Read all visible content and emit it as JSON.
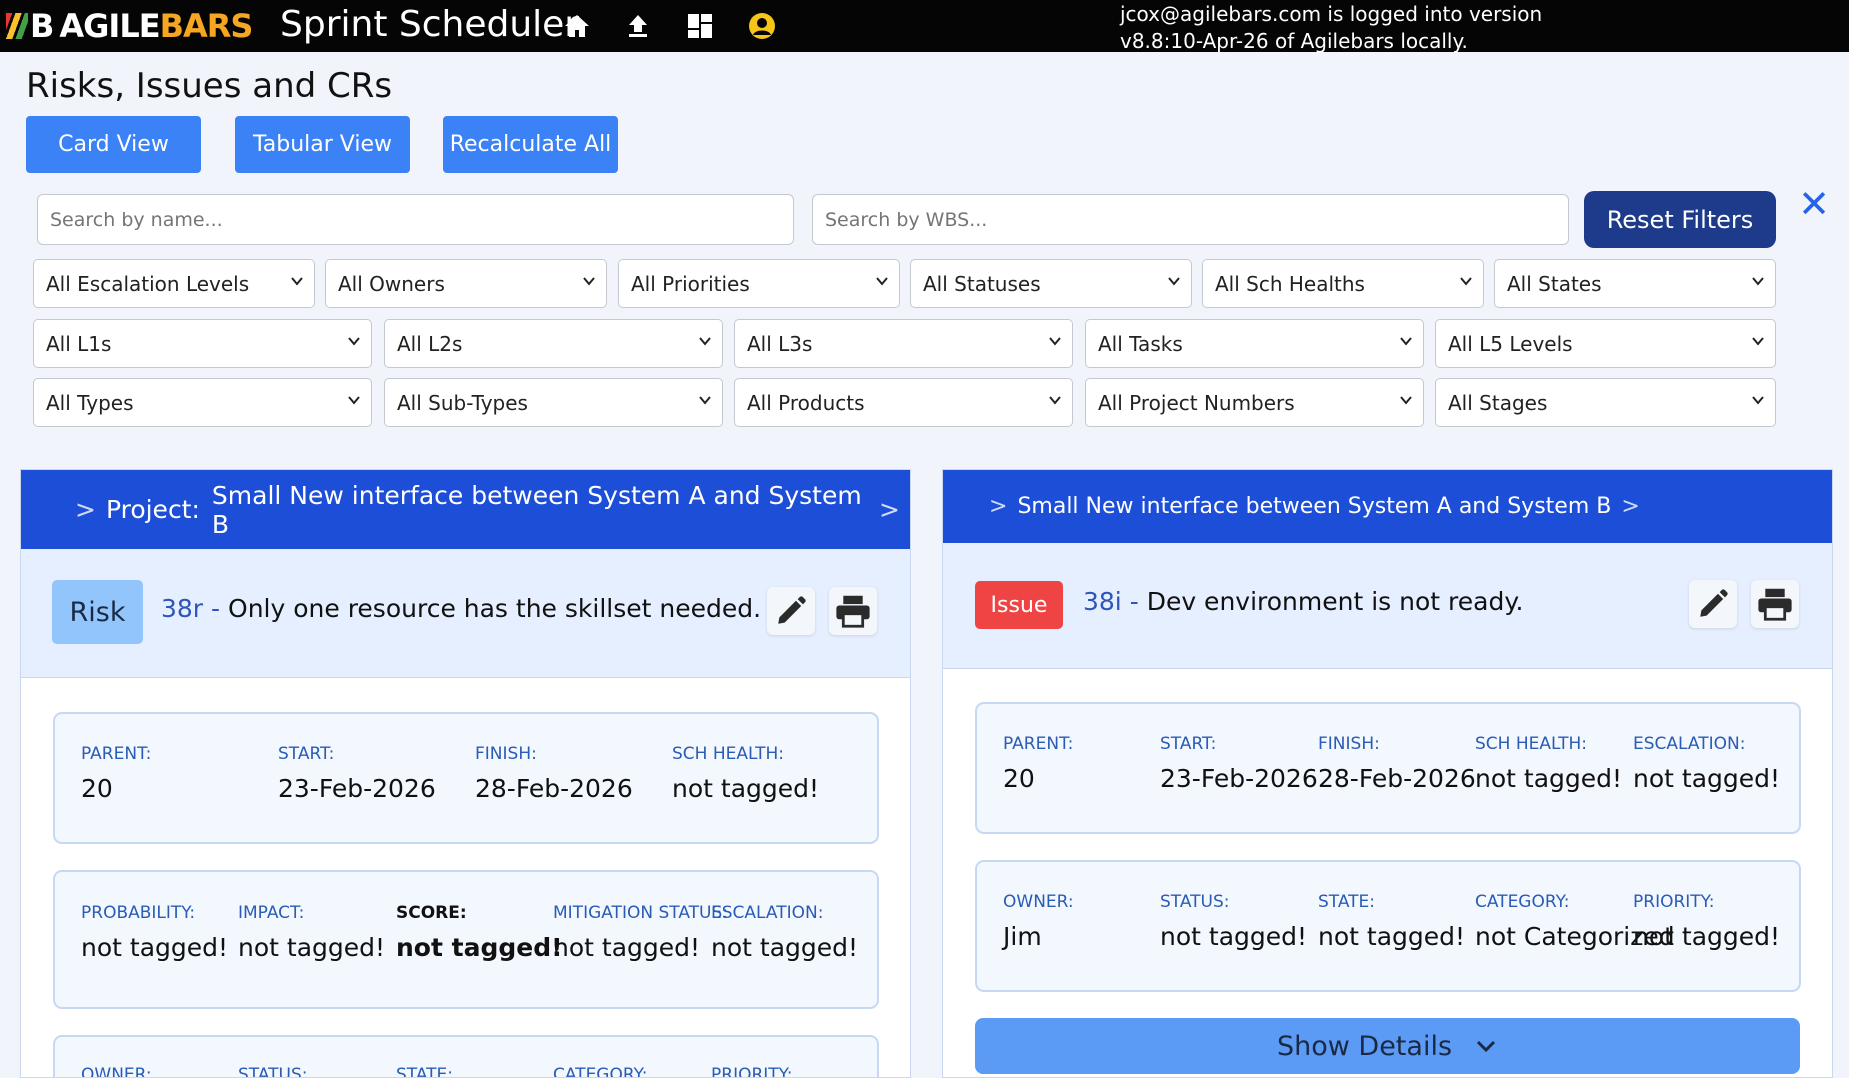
{
  "header": {
    "logo_mark": "B",
    "logo_agile": "AGILE",
    "logo_bars": "BARS",
    "app_name": "Sprint Scheduler",
    "login_line1": "jcox@agilebars.com is logged into version",
    "login_line2": "v8.8:10-Apr-26 of Agilebars locally."
  },
  "page": {
    "title": "Risks, Issues and CRs",
    "buttons": {
      "card_view": "Card View",
      "tabular_view": "Tabular View",
      "recalculate_all": "Recalculate All"
    },
    "search_name_placeholder": "Search by name...",
    "search_wbs_placeholder": "Search by WBS...",
    "reset_filters": "Reset Filters",
    "close": "✕"
  },
  "filters": {
    "row1": [
      "All Escalation Levels",
      "All Owners",
      "All Priorities",
      "All Statuses",
      "All Sch Healths",
      "All States"
    ],
    "row2": [
      "All L1s",
      "All L2s",
      "All L3s",
      "All Tasks",
      "All L5 Levels"
    ],
    "row3": [
      "All Types",
      "All Sub-Types",
      "All Products",
      "All Project Numbers",
      "All Stages"
    ]
  },
  "cards": [
    {
      "header_prefix": "Project:",
      "header_title": "Small New interface between System A and System B",
      "type_badge": "Risk",
      "item_id": "38r -",
      "item_title": "Only one resource has the skillset needed.",
      "box1": {
        "labels": [
          "PARENT:",
          "START:",
          "FINISH:",
          "SCH HEALTH:"
        ],
        "values": [
          "20",
          "23-Feb-2026",
          "28-Feb-2026",
          "not tagged!"
        ]
      },
      "box2": {
        "labels": [
          "PROBABILITY:",
          "IMPACT:",
          "SCORE:",
          "MITIGATION STATUS:",
          "ESCALATION:"
        ],
        "values": [
          "not tagged!",
          "not tagged!",
          "not tagged!",
          "not tagged!",
          "not tagged!"
        ]
      },
      "box3": {
        "labels": [
          "OWNER:",
          "STATUS:",
          "STATE:",
          "CATEGORY:",
          "PRIORITY:"
        ]
      }
    },
    {
      "header_title": "Small New interface between System A and System B",
      "type_badge": "Issue",
      "item_id": "38i -",
      "item_title": "Dev environment is not ready.",
      "box1": {
        "labels": [
          "PARENT:",
          "START:",
          "FINISH:",
          "SCH HEALTH:",
          "ESCALATION:"
        ],
        "values": [
          "20",
          "23-Feb-2026",
          "28-Feb-2026",
          "not tagged!",
          "not tagged!"
        ]
      },
      "box2": {
        "labels": [
          "OWNER:",
          "STATUS:",
          "STATE:",
          "CATEGORY:",
          "PRIORITY:"
        ],
        "values": [
          "Jim",
          "not tagged!",
          "not tagged!",
          "not Categorized",
          "not tagged!"
        ]
      },
      "show_details": "Show Details"
    }
  ],
  "colors": {
    "topbar": "#050505",
    "primary_button": "#3b82f6",
    "reset_button": "#1e3a8a",
    "card_header": "#1d4ed8",
    "risk_badge": "#93c5fd",
    "issue_badge": "#ef4444",
    "label_blue": "#2a5bb5"
  },
  "icons": [
    "home-icon",
    "upload-icon",
    "dashboard-icon",
    "user-icon",
    "pencil-icon",
    "printer-icon",
    "chevron-down-icon",
    "close-icon"
  ]
}
